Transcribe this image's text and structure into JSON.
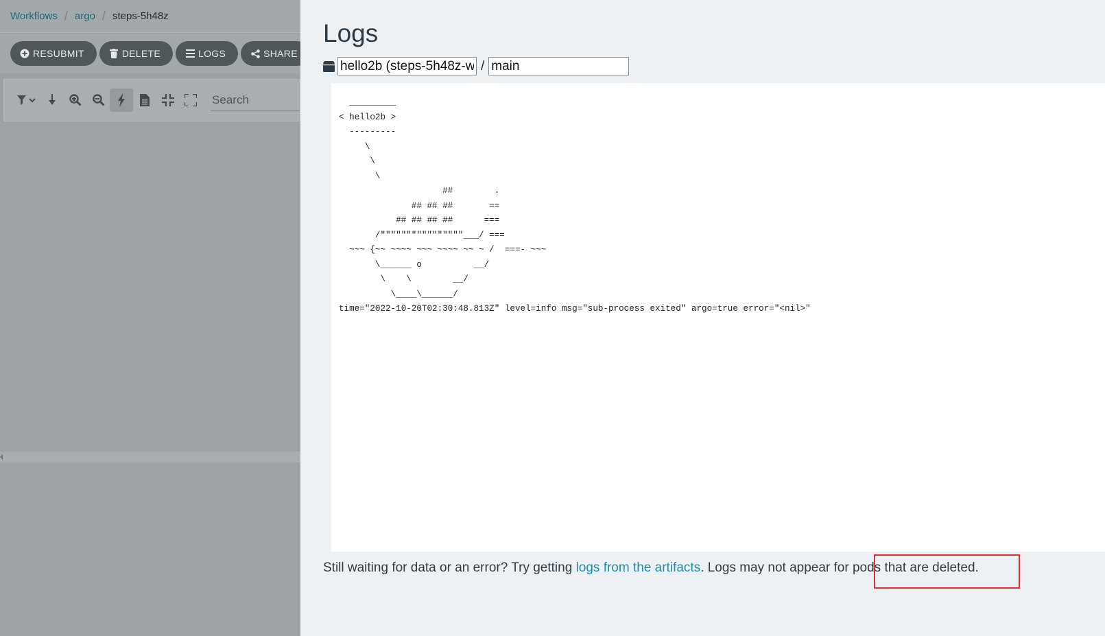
{
  "breadcrumb": {
    "items": [
      "Workflows",
      "argo"
    ],
    "current": "steps-5h48z"
  },
  "actions": {
    "resubmit": "RESUBMIT",
    "delete": "DELETE",
    "logs": "LOGS",
    "share": "SHARE"
  },
  "toolbar": {
    "search_placeholder": "Search",
    "tools": [
      "filter-icon",
      "download-icon",
      "zoom-in-icon",
      "zoom-out-icon",
      "lightning-icon",
      "document-icon",
      "collapse-icon",
      "expand-icon"
    ]
  },
  "logs_panel": {
    "title": "Logs",
    "pod_value": "hello2b (steps-5h48z-w",
    "separator": "/",
    "container_value": "main",
    "log_lines": [
      "  _________",
      "< hello2b >",
      "  ---------",
      "     \\",
      "      \\",
      "       \\",
      "                    ##        .",
      "              ## ## ##       ==",
      "           ## ## ## ##      ===",
      "       /\"\"\"\"\"\"\"\"\"\"\"\"\"\"\"\"___/ ===",
      "  ~~~ {~~ ~~~~ ~~~ ~~~~ ~~ ~ /  ===- ~~~",
      "       \\______ o          __/",
      "        \\    \\        __/",
      "          \\____\\______/",
      "time=\"2022-10-20T02:30:48.813Z\" level=info msg=\"sub-process exited\" argo=true error=\"<nil>\""
    ],
    "footer_before": "Still waiting for data or an error? Try getting ",
    "footer_link": "logs from the artifacts",
    "footer_after": ". Logs may not appear for pods that are deleted."
  },
  "colors": {
    "accent_link": "#1b8fa8",
    "highlight": "#e03232",
    "button_bg": "#50575b"
  }
}
